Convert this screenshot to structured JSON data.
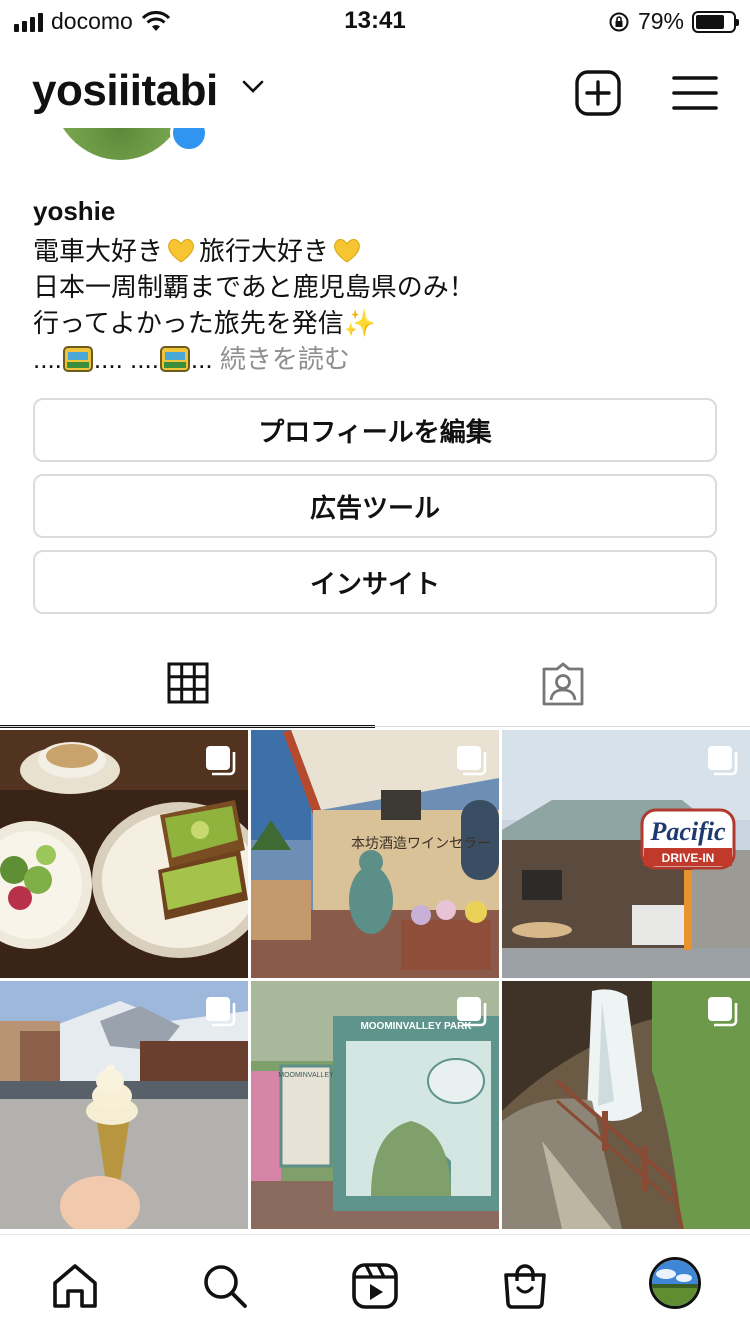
{
  "status_bar": {
    "carrier": "docomo",
    "time": "13:41",
    "battery": "79%",
    "battery_level": 0.79
  },
  "header": {
    "username": "yosiiitabi",
    "icons": [
      "chevron-down-icon",
      "new-post-icon",
      "menu-icon"
    ]
  },
  "bio": {
    "display_name": "yoshie",
    "line1_a": "電車大好き",
    "line1_b": "旅行大好き",
    "line2": "日本一周制覇まであと鹿児島県のみ！",
    "line3": "行ってよかった旅先を発信",
    "line4_a": "....",
    "line4_b": ".... ....",
    "line4_c": "...",
    "more_link": "続きを読む"
  },
  "buttons": {
    "edit_profile": "プロフィールを編集",
    "ad_tools": "広告ツール",
    "insights": "インサイト"
  },
  "tabs": [
    {
      "name": "posts-grid",
      "icon": "grid-icon",
      "active": true
    },
    {
      "name": "tagged",
      "icon": "tagged-person-icon",
      "active": false
    }
  ],
  "photos": [
    {
      "subject": "cafe-plates",
      "text": ""
    },
    {
      "subject": "winery-building",
      "text": "本坊酒造ワインセラー"
    },
    {
      "subject": "pacific-drive-in",
      "text": "Pacific",
      "subtext": "DRIVE-IN"
    },
    {
      "subject": "soft-serve-mountains",
      "text": ""
    },
    {
      "subject": "moominvalley-park",
      "text": "MOOMINVALLEY PARK",
      "sign": "MOOMINVALLEY"
    },
    {
      "subject": "waterfall-path",
      "text": ""
    }
  ],
  "bottom_nav": [
    "home-icon",
    "search-icon",
    "reels-icon",
    "shop-icon",
    "profile-avatar"
  ],
  "colors": {
    "accent_blue": "#2f95f0",
    "border": "#dbdbdb",
    "muted_text": "#8e8e8e"
  }
}
